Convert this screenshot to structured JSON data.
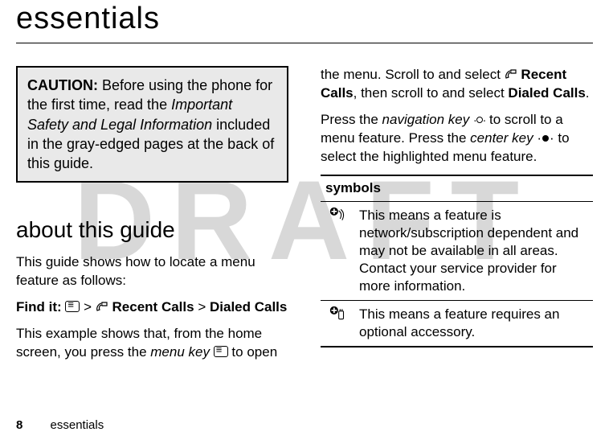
{
  "watermark": "DRAFT",
  "title": "essentials",
  "caution": {
    "label": "CAUTION:",
    "before": " Before using the phone for the first time, read the ",
    "doc_title": "Important Safety and Legal Information",
    "after": " included in the gray-edged pages at the back of this guide."
  },
  "left": {
    "section_heading": "about this guide",
    "intro": "This guide shows how to locate a menu feature as follows:",
    "findit_label": "Find it:",
    "gt1": ">",
    "recent_calls": "Recent Calls",
    "gt2": ">",
    "dialed_calls": "Dialed Calls",
    "example_a": "This example shows that, from the home screen, you press the ",
    "menu_key_text": "menu key",
    "example_b": " to open"
  },
  "right": {
    "top_a": "the menu. Scroll to and select ",
    "recent_calls": "Recent Calls",
    "top_b": ", then scroll to and select ",
    "dialed_calls": "Dialed Calls",
    "top_c": ".",
    "nav_a": "Press the ",
    "nav_key": "navigation key",
    "nav_b": " to scroll to a menu feature. Press the ",
    "center_key": "center key",
    "nav_c": " to select the highlighted menu feature."
  },
  "symbols": {
    "header": "symbols",
    "rows": [
      {
        "icon": "network-feature",
        "text": "This means a feature is network/subscription dependent and may not be available in all areas. Contact your service provider for more information."
      },
      {
        "icon": "accessory-feature",
        "text": "This means a feature requires an optional accessory."
      }
    ]
  },
  "footer": {
    "page_number": "8",
    "section": "essentials"
  }
}
